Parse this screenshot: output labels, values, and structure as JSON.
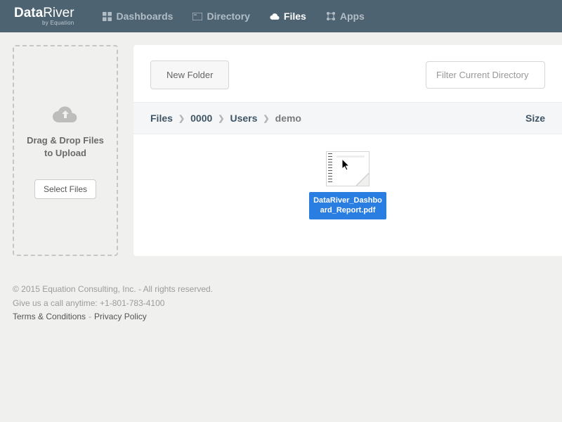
{
  "brand": {
    "name_a": "Data",
    "name_b": "River",
    "subtitle": "by Equation"
  },
  "nav": {
    "dashboards": "Dashboards",
    "directory": "Directory",
    "files": "Files",
    "apps": "Apps"
  },
  "upload": {
    "title_line1": "Drag & Drop Files",
    "title_line2": "to Upload",
    "select_button": "Select Files"
  },
  "toolbar": {
    "new_folder": "New Folder",
    "filter_placeholder": "Filter Current Directory"
  },
  "breadcrumb": {
    "items": [
      "Files",
      "0000",
      "Users",
      "demo"
    ],
    "size_header": "Size"
  },
  "file": {
    "name": "DataRiver_Dashboard_Report.pdf"
  },
  "footer": {
    "copyright": "© 2015 Equation Consulting, Inc. - All rights reserved.",
    "call": "Give us a call anytime: +1-801-783-4100",
    "terms": "Terms & Conditions",
    "privacy": "Privacy Policy"
  }
}
